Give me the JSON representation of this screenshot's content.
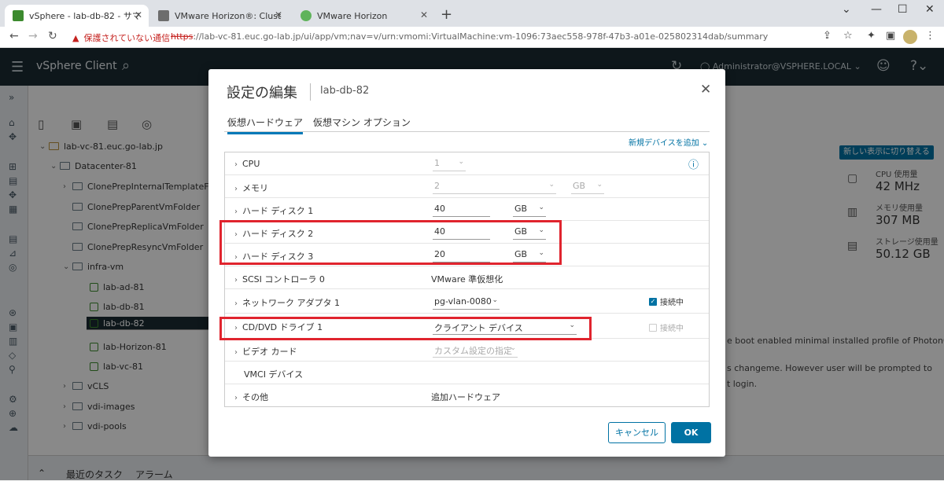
{
  "browser": {
    "tabs": [
      {
        "title": "vSphere - lab-db-82 - サマリ"
      },
      {
        "title": "VMware Horizon®: Cluster-LAB-"
      },
      {
        "title": "VMware Horizon"
      }
    ],
    "warning": "保護されていない通信",
    "url_scheme": "https",
    "url_rest": "://lab-vc-81.euc.go-lab.jp/ui/app/vm;nav=v/urn:vmomi:VirtualMachine:vm-1096:73aec558-978f-47b3-a01e-025802314dab/summary"
  },
  "header": {
    "brand": "vSphere Client",
    "user": "Administrator@VSPHERE.LOCAL"
  },
  "tree": {
    "root": "lab-vc-81.euc.go-lab.jp",
    "datacenter": "Datacenter-81",
    "folders": [
      "ClonePrepInternalTemplateFolder",
      "ClonePrepParentVmFolder",
      "ClonePrepReplicaVmFolder",
      "ClonePrepResyncVmFolder"
    ],
    "infra_folder": "infra-vm",
    "vms": [
      "lab-ad-81",
      "lab-db-81",
      "lab-db-82",
      "lab-Horizon-81",
      "lab-vc-81"
    ],
    "other_folders": [
      "vCLS",
      "vdi-images",
      "vdi-pools"
    ]
  },
  "right_panel": {
    "switch_label": "新しい表示に切り替える",
    "cpu_label": "CPU 使用量",
    "cpu_value": "42 MHz",
    "mem_label": "メモリ使用量",
    "mem_value": "307 MB",
    "storage_label": "ストレージ使用量",
    "storage_value": "50.12 GB",
    "desc1": "e boot enabled minimal installed profile of PhotonOS.",
    "desc2": "s changeme. However user will be prompted to",
    "desc3": "t login."
  },
  "bottom": {
    "tasks": "最近のタスク",
    "alarms": "アラーム"
  },
  "modal": {
    "title": "設定の編集",
    "subtitle": "lab-db-82",
    "tab_hw": "仮想ハードウェア",
    "tab_opts": "仮想マシン オプション",
    "add_device": "新規デバイスを追加",
    "rows": {
      "cpu": {
        "label": "CPU",
        "value": "1"
      },
      "mem": {
        "label": "メモリ",
        "value": "2",
        "unit": "GB"
      },
      "disk1": {
        "label": "ハード ディスク 1",
        "value": "40",
        "unit": "GB"
      },
      "disk2": {
        "label": "ハード ディスク 2",
        "value": "40",
        "unit": "GB"
      },
      "disk3": {
        "label": "ハード ディスク 3",
        "value": "20",
        "unit": "GB"
      },
      "scsi": {
        "label": "SCSI コントローラ 0",
        "value": "VMware 準仮想化"
      },
      "net": {
        "label": "ネットワーク アダプタ 1",
        "value": "pg-vlan-0080",
        "check": "接続中"
      },
      "cd": {
        "label": "CD/DVD ドライブ 1",
        "value": "クライアント デバイス",
        "check": "接続中"
      },
      "video": {
        "label": "ビデオ カード",
        "value": "カスタム設定の指定"
      },
      "vmci": {
        "label": "VMCI デバイス"
      },
      "other": {
        "label": "その他",
        "value": "追加ハードウェア"
      }
    },
    "cancel": "キャンセル",
    "ok": "OK"
  },
  "colors": {
    "accent": "#0072a3",
    "highlight": "#e0242e",
    "header_bg": "#1b2a32"
  }
}
